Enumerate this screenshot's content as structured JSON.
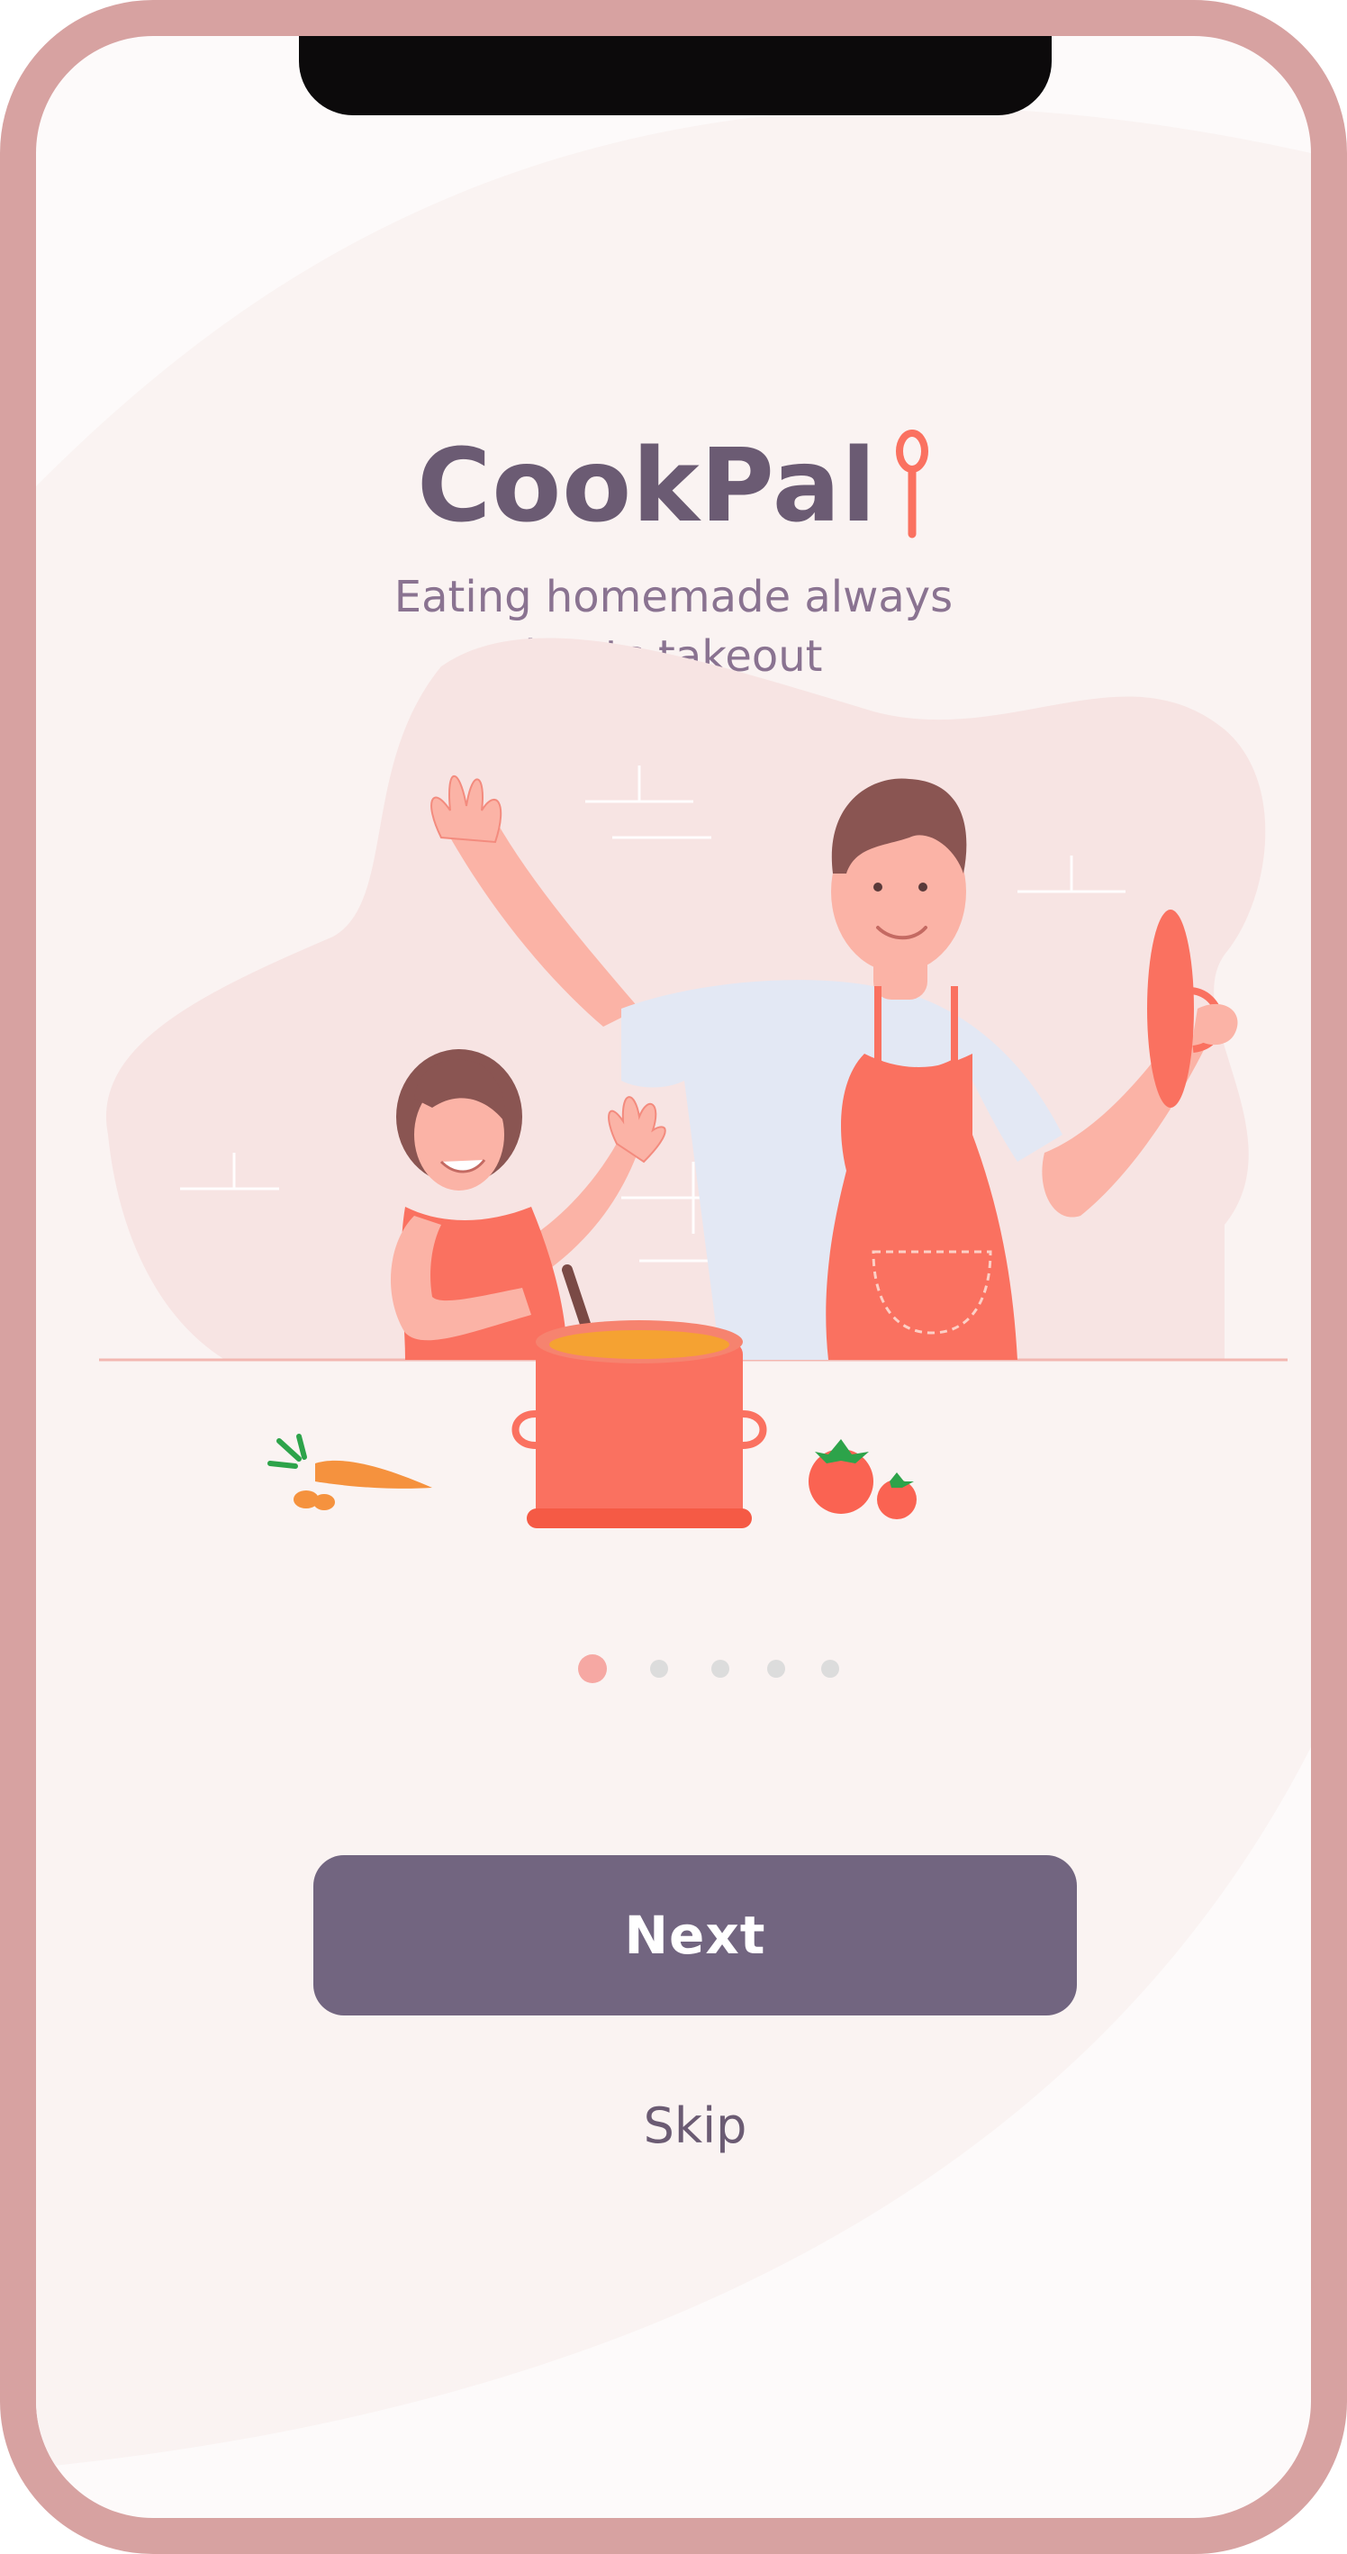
{
  "app": {
    "name": "CookPal",
    "tagline_line1": "Eating homemade always",
    "tagline_line2": "beats takeout"
  },
  "onboarding": {
    "pages_total": 5,
    "current_page": 1,
    "next_label": "Next",
    "skip_label": "Skip"
  },
  "icons": {
    "logo_icon": "spoon-icon"
  },
  "colors": {
    "frame": "#d7a2a1",
    "brand_text": "#6b5b73",
    "accent": "#fa7160",
    "button": "#726580",
    "dot_active": "#f6a8a3",
    "dot_inactive": "#dcdcdc"
  }
}
